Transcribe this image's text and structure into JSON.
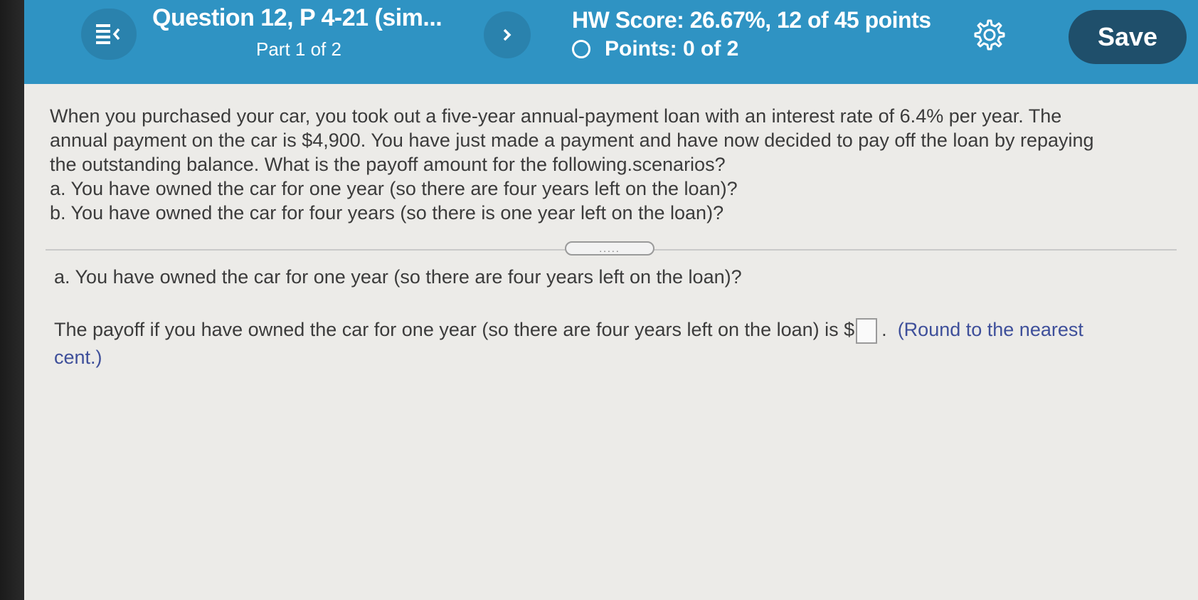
{
  "header": {
    "question_title": "Question 12, P 4-21 (sim...",
    "part_label": "Part 1 of 2",
    "hw_score": "HW Score: 26.67%, 12 of 45 points",
    "points": "Points: 0 of 2",
    "save_label": "Save",
    "accent_color": "#2f93c3",
    "save_color": "#1f4f6b",
    "icons": [
      "menu-collapse-icon",
      "chevron-right-icon",
      "gear-icon",
      "circle-status-icon"
    ]
  },
  "problem": {
    "lines": [
      "When you purchased your car, you took out a five-year annual-payment loan with an interest rate of 6.4% per year. The",
      "annual payment on the car is $4,900. You have just made a payment and have now decided to pay off the loan by repaying",
      "the outstanding balance. What is the payoff amount for the following.scenarios?",
      "a. You have owned the car for one year (so there are four years left on the loan)?",
      "b. You have owned the car for four years (so there is one year left on the loan)?"
    ]
  },
  "divider_handle": ".....",
  "part_a": {
    "question": "a. You have owned the car for one year (so there are four years left on the loan)?",
    "answer_prefix": "The payoff if you have owned the car for one year (so there are four years left on the loan) is $",
    "answer_value": "",
    "answer_suffix": ".",
    "round_note_line1": "(Round to the nearest",
    "round_note_line2": "cent.)"
  }
}
